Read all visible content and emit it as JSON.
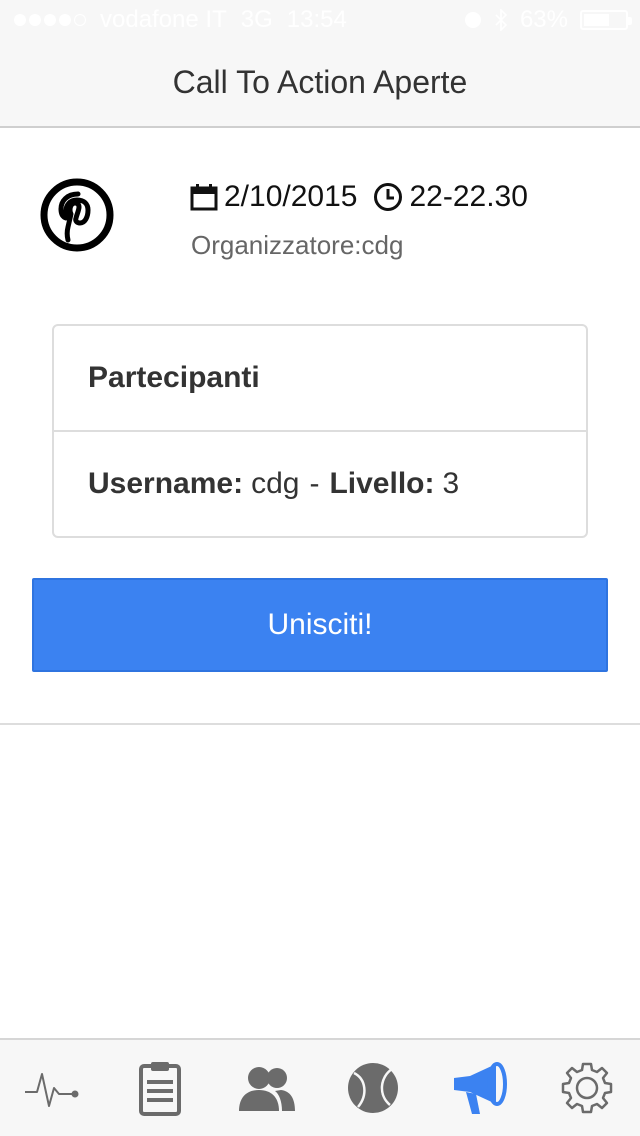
{
  "status_bar": {
    "carrier": "vodafone IT",
    "network": "3G",
    "time": "13:54",
    "battery_percent": "63%",
    "battery_level": 0.63
  },
  "nav": {
    "title": "Call To Action Aperte"
  },
  "event": {
    "logo_icon": "pinterest-icon",
    "date": "2/10/2015",
    "time_range": "22-22.30",
    "organizer": "Organizzatore:cdg"
  },
  "participants": {
    "title": "Partecipanti",
    "rows": [
      {
        "username_label": "Username:",
        "username": "cdg",
        "separator": "-",
        "level_label": "Livello:",
        "level": "3"
      }
    ]
  },
  "join_button": {
    "label": "Unisciti!"
  },
  "tabbar": {
    "active_color": "#3b82f1",
    "inactive_color": "#6b6b6b",
    "items": [
      {
        "icon": "activity-icon",
        "active": false
      },
      {
        "icon": "clipboard-icon",
        "active": false
      },
      {
        "icon": "users-icon",
        "active": false
      },
      {
        "icon": "ball-icon",
        "active": false
      },
      {
        "icon": "megaphone-icon",
        "active": true
      },
      {
        "icon": "gear-icon",
        "active": false
      }
    ]
  }
}
